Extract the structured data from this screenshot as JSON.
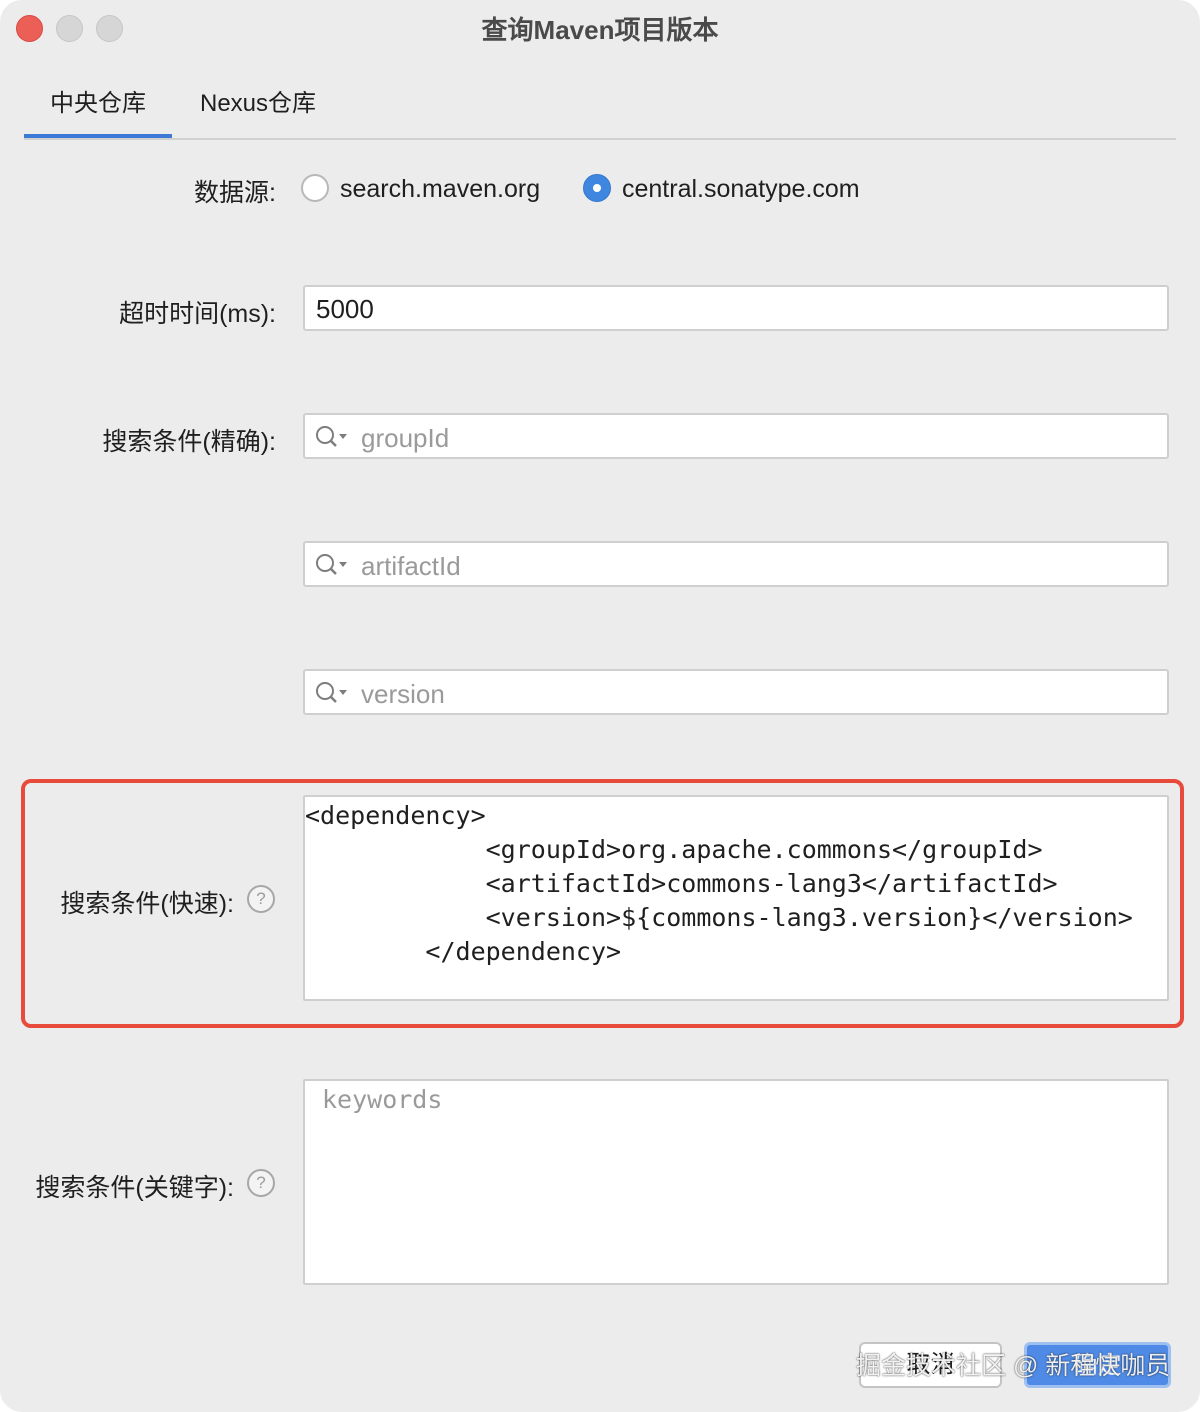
{
  "window": {
    "title": "查询Maven项目版本"
  },
  "tabs": [
    {
      "label": "中央仓库"
    },
    {
      "label": "Nexus仓库"
    }
  ],
  "form": {
    "datasource": {
      "label": "数据源:",
      "options": [
        "search.maven.org",
        "central.sonatype.com"
      ],
      "selected": "central.sonatype.com"
    },
    "timeout": {
      "label": "超时时间(ms):",
      "value": "5000"
    },
    "exact": {
      "label": "搜索条件(精确):",
      "groupId_placeholder": "groupId",
      "artifactId_placeholder": "artifactId",
      "version_placeholder": "version"
    },
    "quick": {
      "label": "搜索条件(快速):",
      "help": "?",
      "value": "<dependency>\n            <groupId>org.apache.commons</groupId>\n            <artifactId>commons-lang3</artifactId>\n            <version>${commons-lang3.version}</version>\n        </dependency>"
    },
    "keywords": {
      "label": "搜索条件(关键字):",
      "help": "?",
      "placeholder": "keywords"
    }
  },
  "buttons": {
    "cancel": "取消",
    "ok": "确定"
  },
  "watermark": "掘金技术社区 @ 新程快咖员",
  "colors": {
    "accent": "#3d7ad6",
    "highlight_border": "#e84a3b",
    "primary_button": "#4f8be6"
  }
}
